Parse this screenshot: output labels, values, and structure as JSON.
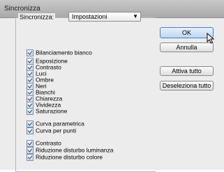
{
  "window": {
    "title": "Sincronizza"
  },
  "sync": {
    "label": "Sincronizza:",
    "selected": "Impostazioni"
  },
  "options": [
    "Bilanciamento bianco",
    "Esposizione",
    "Contrasto",
    "Luci",
    "Ombre",
    "Neri",
    "Bianchi",
    "Chiarezza",
    "Vividezza",
    "Saturazione",
    "Curva parametrica",
    "Curva per punti",
    "Contrasto",
    "Riduzione disturbo luminanza",
    "Riduzione disturbo colore"
  ],
  "buttons": {
    "ok": "OK",
    "cancel": "Annulla",
    "select_all": "Attiva tutto",
    "deselect_all": "Deseleziona tutto"
  },
  "icons": {
    "dropdown": "chevron-down-icon",
    "cursor": "mouse-pointer-icon",
    "check": "checkmark-icon"
  }
}
